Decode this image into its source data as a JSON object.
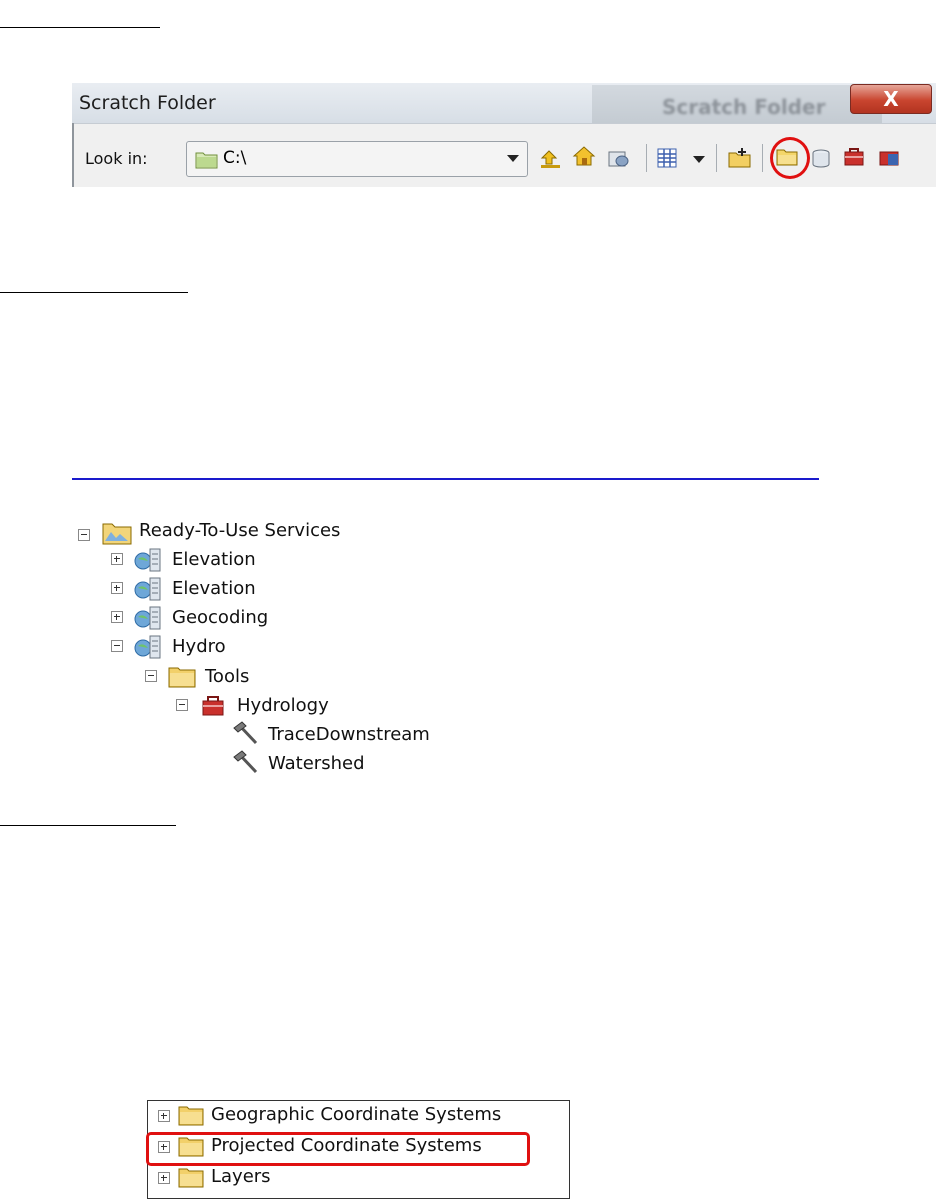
{
  "scratch_dialog": {
    "title": "Scratch Folder",
    "ghost_title": "Scratch Folder",
    "close_label": "X",
    "look_in_label": "Look in:",
    "look_in_value": "C:\\"
  },
  "tree": {
    "root": "Ready-To-Use Services",
    "items": [
      "Elevation",
      "Elevation",
      "Geocoding",
      "Hydro",
      "Tools",
      "Hydrology",
      "TraceDownstream",
      "Watershed"
    ]
  },
  "coordinate_systems": {
    "items": [
      "Geographic Coordinate Systems",
      "Projected Coordinate Systems",
      "Layers"
    ]
  },
  "colors": {
    "highlight": "#e01010",
    "link": "#1a1acc"
  }
}
